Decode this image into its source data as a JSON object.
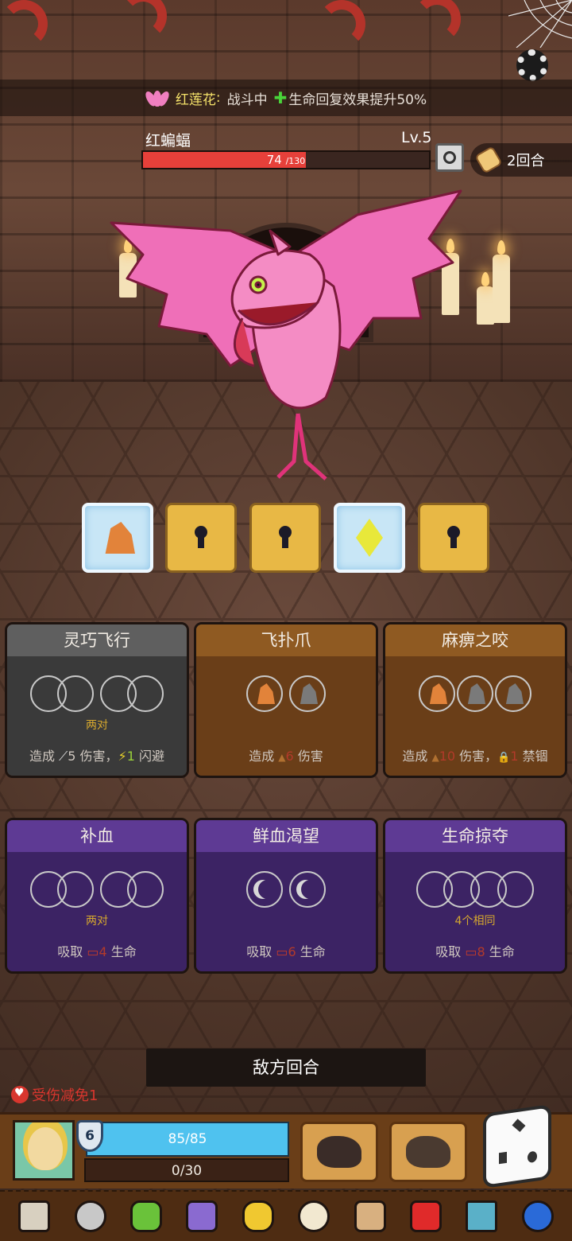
{
  "banner": {
    "flower_name": "红莲花",
    "colon": ":",
    "status": "战斗中",
    "plus": "✚",
    "effect": "生命回复效果提升50%"
  },
  "enemy": {
    "name": "红蝙蝠",
    "level": "Lv.5",
    "hp_current": "74",
    "hp_max": "/130",
    "hp_fraction": 0.569,
    "round": "2回合"
  },
  "dice_slots": [
    {
      "type": "frozen",
      "content": "shard-orange"
    },
    {
      "type": "locked"
    },
    {
      "type": "locked"
    },
    {
      "type": "frozen",
      "content": "diamond-yellow"
    },
    {
      "type": "locked"
    }
  ],
  "skills": [
    {
      "title": "灵巧飞行",
      "style": "gray",
      "req": "两对",
      "effect_pre": "造成 ",
      "icon1": "⟋",
      "num1": "5",
      "mid": " 伤害，",
      "icon2": "⚡",
      "num2": "1",
      "post": " 闪避"
    },
    {
      "title": "飞扑爪",
      "style": "brown",
      "req": "",
      "effect_pre": "造成 ",
      "icon1": "▲",
      "num1": "6",
      "mid": " 伤害",
      "icon2": "",
      "num2": "",
      "post": ""
    },
    {
      "title": "麻痹之咬",
      "style": "brown",
      "req": "",
      "effect_pre": "造成 ",
      "icon1": "▲",
      "num1": "10",
      "mid": " 伤害，",
      "icon2": "🔒",
      "num2": "1",
      "post": " 禁锢"
    },
    {
      "title": "补血",
      "style": "purple",
      "req": "两对",
      "effect_pre": "吸取 ",
      "icon1": "▭",
      "num1": "4",
      "mid": " 生命",
      "icon2": "",
      "num2": "",
      "post": ""
    },
    {
      "title": "鲜血渴望",
      "style": "purple",
      "req": "",
      "effect_pre": "吸取 ",
      "icon1": "▭",
      "num1": "6",
      "mid": " 生命",
      "icon2": "",
      "num2": "",
      "post": ""
    },
    {
      "title": "生命掠夺",
      "style": "purple",
      "req": "4个相同",
      "effect_pre": "吸取 ",
      "icon1": "▭",
      "num1": "8",
      "mid": " 生命",
      "icon2": "",
      "num2": "",
      "post": ""
    }
  ],
  "turn_button": "敌方回合",
  "damage_reduction": "受伤减免1",
  "player": {
    "shield_level": "6",
    "shield": "85/85",
    "hp": "0/30"
  },
  "relics": [
    "scroll-icon",
    "ring-icon",
    "tree-icon",
    "dragon-icon",
    "heart-card-icon",
    "sun-icon",
    "hourglass-icon",
    "ruby-icon",
    "pickaxe-icon",
    "blue-spirit-icon"
  ],
  "colors": {
    "hp_red": "#e6403a",
    "shield_blue": "#4fc2ef",
    "gold": "#f5e26a",
    "purple_card": "#5e3a94",
    "brown_card": "#8f5a22",
    "gray_card": "#5f5f5f"
  }
}
